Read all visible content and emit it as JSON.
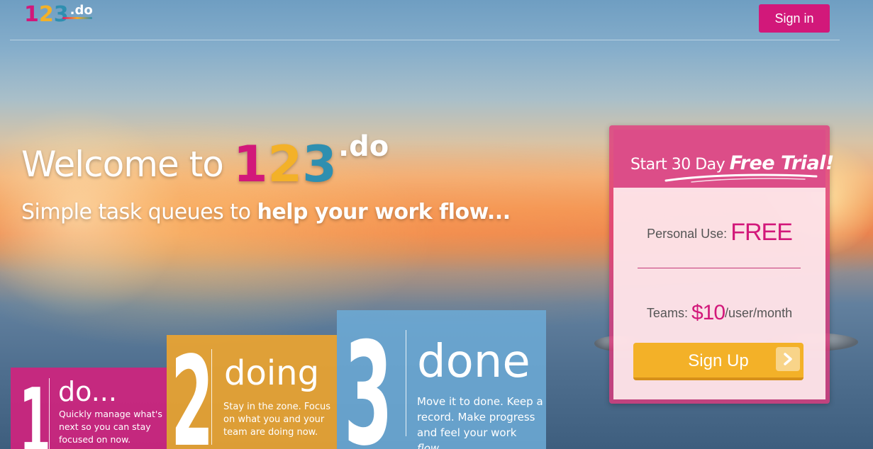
{
  "logo": {
    "d1": "1",
    "d2": "2",
    "d3": "3",
    "suffix": ".do"
  },
  "header": {
    "signin_label": "Sign in"
  },
  "hero": {
    "welcome": "Welcome to",
    "n1": "1",
    "n2": "2",
    "n3": "3",
    "suffix": ".do",
    "subtitle_plain": "Simple task queues to",
    "subtitle_bold": "help your work flow..."
  },
  "pricing": {
    "trial_prefix": "Start 30 Day",
    "trial_emphasis": "Free Trial!",
    "personal_label": "Personal Use:",
    "personal_value": "FREE",
    "teams_label": "Teams:",
    "teams_value": "$10",
    "teams_suffix": "/user/month",
    "signup_label": "Sign Up"
  },
  "steps": [
    {
      "number": "1",
      "word": "do...",
      "desc": "Quickly manage what's next so you can stay focused on now."
    },
    {
      "number": "2",
      "word": "doing",
      "desc": "Stay in the zone. Focus on what you and your team are doing now."
    },
    {
      "number": "3",
      "word": "done",
      "desc_main": "Move it to done. Keep a record. Make progress and feel your work",
      "desc_em": "flow",
      "desc_end": "."
    }
  ],
  "colors": {
    "magenta": "#d2187a",
    "orange": "#f3b128",
    "blue": "#2f8fb0",
    "step1": "#d6207d",
    "step2": "#f3a62b",
    "step3": "#6caad5"
  },
  "icons": {
    "signup_arrow": "chevron-right-icon"
  }
}
